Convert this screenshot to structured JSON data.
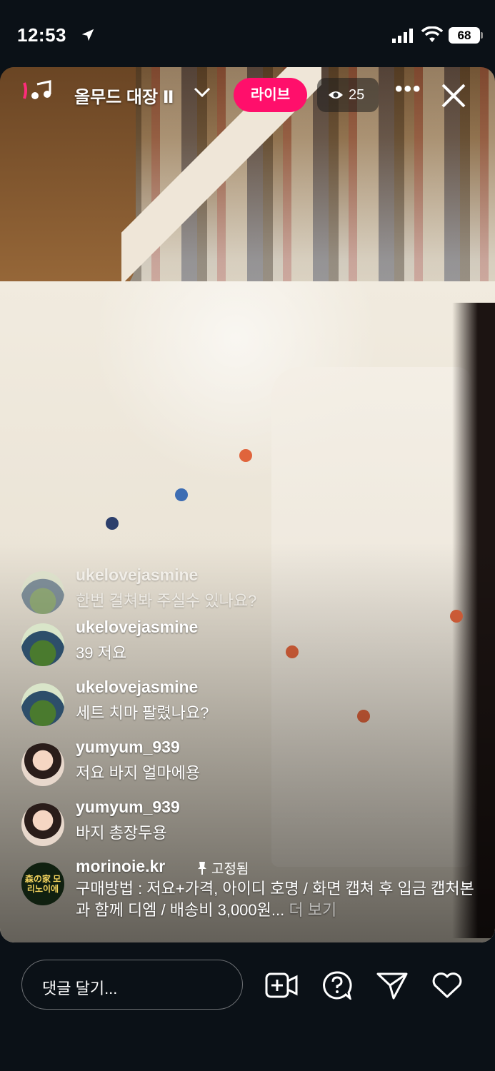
{
  "status_bar": {
    "time": "12:53",
    "battery": "68"
  },
  "header": {
    "channel_name": "올무드 대장 Ⅱ",
    "live_label": "라이브",
    "viewer_count": "25"
  },
  "comments": [
    {
      "user": "ukelovejasmine",
      "text": "한번 걸쳐봐 주실수 있나요?",
      "faded": true
    },
    {
      "user": "ukelovejasmine",
      "text": "39 저요"
    },
    {
      "user": "ukelovejasmine",
      "text": "세트 치마 팔렸나요?"
    },
    {
      "user": "yumyum_939",
      "text": "저요 바지 얼마에용"
    },
    {
      "user": "yumyum_939",
      "text": "바지 총장두용"
    }
  ],
  "pinned": {
    "user": "morinoie.kr",
    "pin_label": "고정됨",
    "avatar_text": "森の家 모리노이에",
    "text": "구매방법 : 저요+가격, 아이디 호명 / 화면 캡쳐 후 입금 캡처본과 함께 디엠 / 배송비 3,000원...",
    "see_more": "더 보기"
  },
  "bottom_bar": {
    "comment_placeholder": "댓글 달기..."
  },
  "colors": {
    "live_badge": "#ff0f6b",
    "background": "#0b1117"
  }
}
